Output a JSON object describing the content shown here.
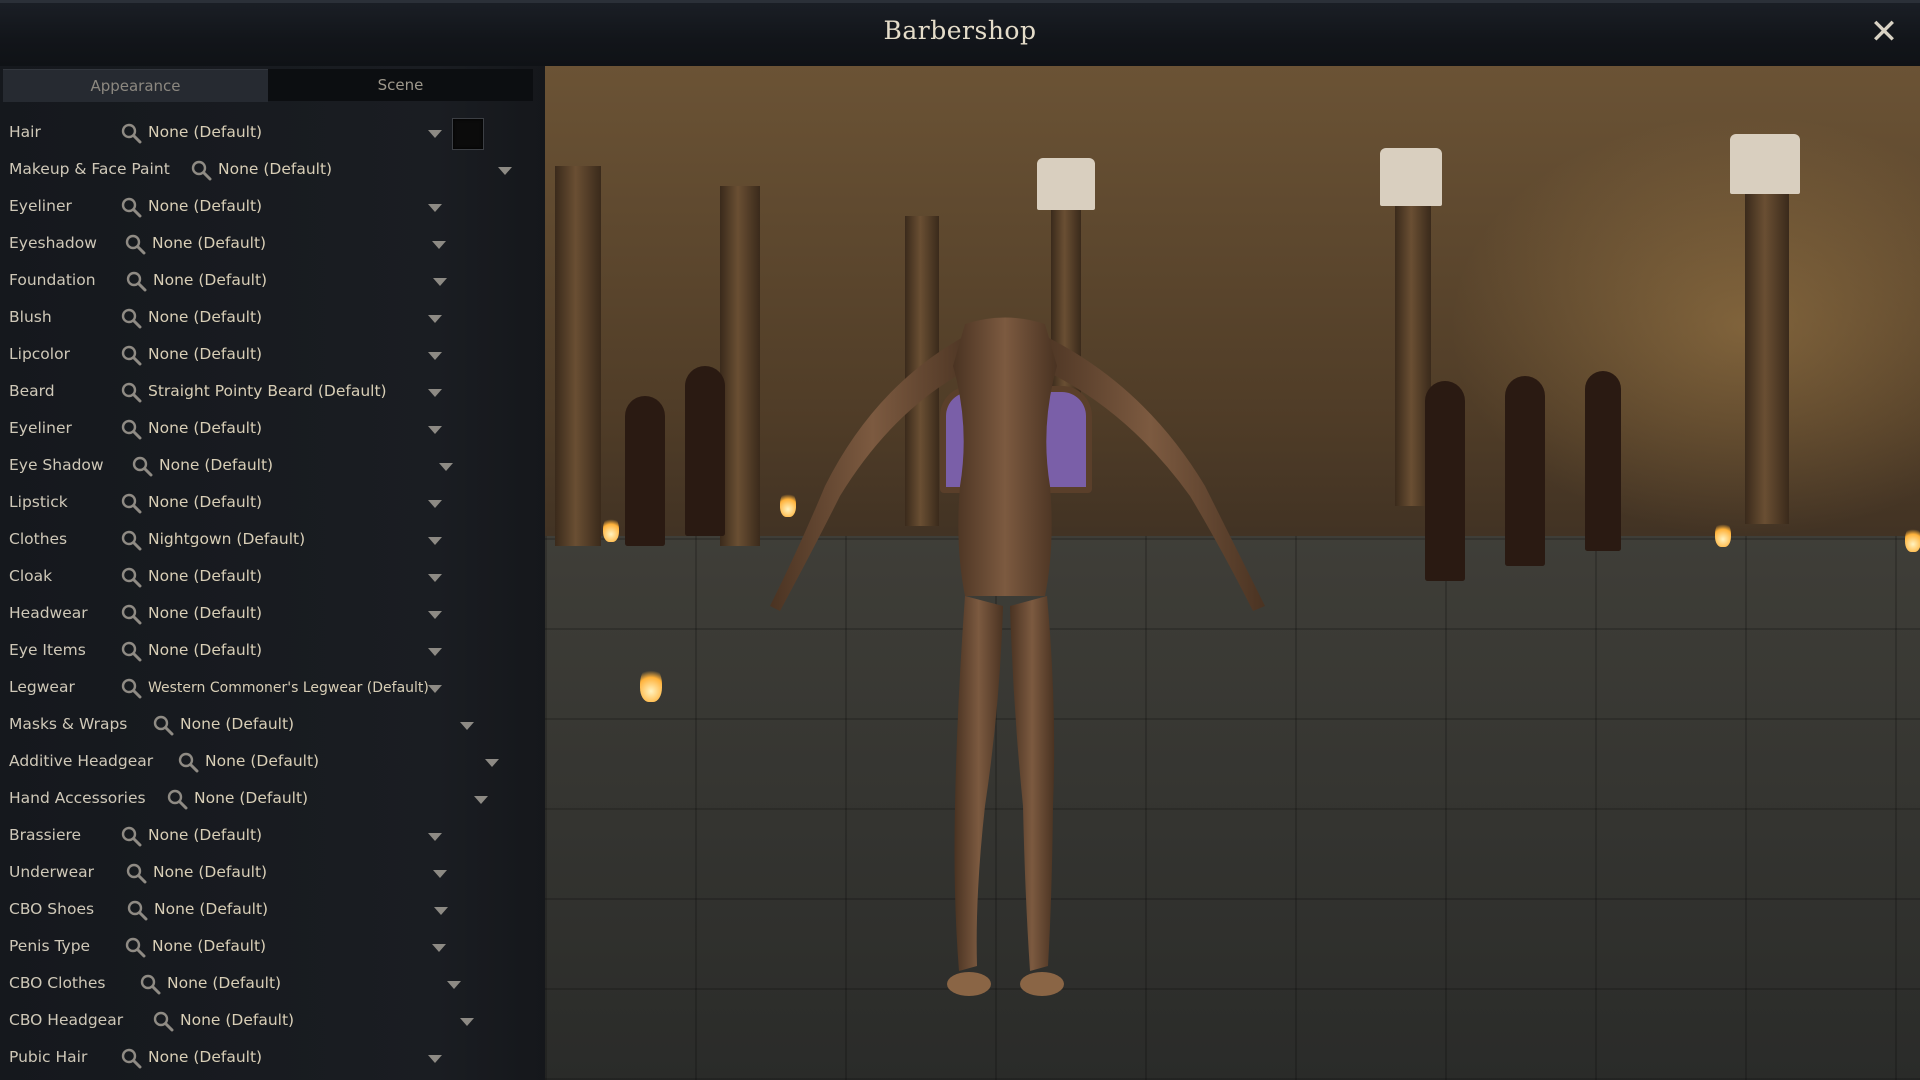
{
  "window": {
    "title": "Barbershop",
    "close_icon": "close-icon"
  },
  "tabs": [
    {
      "label": "Appearance",
      "active": true
    },
    {
      "label": "Scene",
      "active": false
    }
  ],
  "rows": [
    {
      "label": "Hair",
      "value": "None (Default)"
    },
    {
      "label": "Makeup & Face Paint",
      "value": "None (Default)"
    },
    {
      "label": "Eyeliner",
      "value": "None (Default)"
    },
    {
      "label": "Eyeshadow",
      "value": "None (Default)"
    },
    {
      "label": "Foundation",
      "value": "None (Default)"
    },
    {
      "label": "Blush",
      "value": "None (Default)"
    },
    {
      "label": "Lipcolor",
      "value": "None (Default)"
    },
    {
      "label": "Beard",
      "value": "Straight Pointy Beard (Default)"
    },
    {
      "label": "Eyeliner",
      "value": "None (Default)"
    },
    {
      "label": "Eye Shadow",
      "value": "None (Default)"
    },
    {
      "label": "Lipstick",
      "value": "None (Default)"
    },
    {
      "label": "Clothes",
      "value": "Nightgown (Default)"
    },
    {
      "label": "Cloak",
      "value": "None (Default)"
    },
    {
      "label": "Headwear",
      "value": "None (Default)"
    },
    {
      "label": "Eye Items",
      "value": "None (Default)"
    },
    {
      "label": "Legwear",
      "value": "Western Commoner's Legwear (Default)"
    },
    {
      "label": "Masks & Wraps",
      "value": "None (Default)"
    },
    {
      "label": "Additive Headgear",
      "value": "None (Default)"
    },
    {
      "label": "Hand Accessories",
      "value": "None (Default)"
    },
    {
      "label": "Brassiere",
      "value": "None (Default)"
    },
    {
      "label": "Underwear",
      "value": "None (Default)"
    },
    {
      "label": "CBO Shoes",
      "value": "None (Default)"
    },
    {
      "label": "Penis Type",
      "value": "None (Default)"
    },
    {
      "label": "CBO Clothes",
      "value": "None (Default)"
    },
    {
      "label": "CBO Headgear",
      "value": "None (Default)"
    },
    {
      "label": "Pubic Hair",
      "value": "None (Default)"
    }
  ],
  "hair_color": "#0b0b0b",
  "accent": "#d8ceb6"
}
